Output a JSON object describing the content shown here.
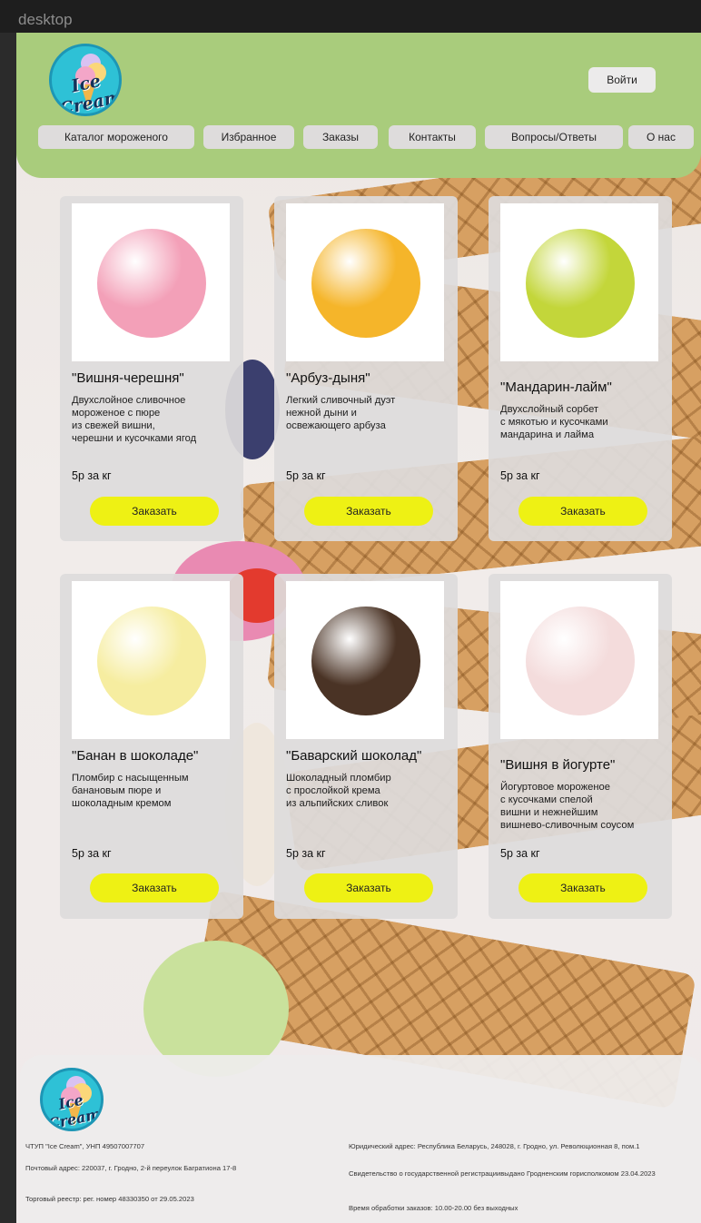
{
  "frame_label": "desktop",
  "header": {
    "logo_text": "Ice Cream",
    "login_label": "Войти",
    "nav": [
      {
        "label": "Каталог мороженого"
      },
      {
        "label": "Избранное"
      },
      {
        "label": "Заказы"
      },
      {
        "label": "Контакты"
      },
      {
        "label": "Вопросы/Ответы"
      },
      {
        "label": "О нас"
      }
    ]
  },
  "products": [
    {
      "title": "\"Вишня-черешня\"",
      "description": "Двухслойное сливочное\nмороженое с пюре\nиз свежей вишни,\nчерешни и кусочками ягод",
      "price": "5р за кг",
      "order_label": "Заказать",
      "color": "#f3a0b8"
    },
    {
      "title": "\"Арбуз-дыня\"",
      "description": "Легкий сливочный дуэт\nнежной дыни и\nосвежающего арбуза",
      "price": "5р за кг",
      "order_label": "Заказать",
      "color": "#f5b52a"
    },
    {
      "title": "\"Мандарин-лайм\"",
      "description": "Двухслойный сорбет\nс мякотью и кусочками\nмандарина и лайма",
      "price": "5р за кг",
      "order_label": "Заказать",
      "color": "#c3d63a"
    },
    {
      "title": "\"Банан в шоколаде\"",
      "description": "Пломбир с насыщенным\nбанановым пюре и\nшоколадным кремом",
      "price": "5р за кг",
      "order_label": "Заказать",
      "color": "#f6eda0"
    },
    {
      "title": "\"Баварский шоколад\"",
      "description": "Шоколадный пломбир\nс прослойкой крема\nиз альпийских сливок",
      "price": "5р за кг",
      "order_label": "Заказать",
      "color": "#4a3325"
    },
    {
      "title": "\"Вишня в йогурте\"",
      "description": "Йогуртовое мороженое\nс кусочками спелой\nвишни и нежнейшим\nвишнево-сливочным соусом",
      "price": "5р за кг",
      "order_label": "Заказать",
      "color": "#f4dcdc"
    }
  ],
  "footer": {
    "logo_text": "Ice Cream",
    "company": "ЧТУП \"Ice Cream\", УНП 49507007707",
    "postal": "Почтовый адрес: 220037, г. Гродно, 2-й переулок Багратиона 17-8",
    "registry": "Торговый реестр: рег. номер 48330350 от 29.05.2023",
    "legal": "Юридический адрес: Республика Беларусь, 248028, г. Гродно, ул. Революционная 8, пом.1",
    "certificate": "Свидетельство о государственной регистрациивыдано Гродненским горисполкомом 23.04.2023",
    "hours": "Время обработки заказов: 10.00-20.00 без выходных"
  },
  "colors": {
    "header_bg": "#a9cc7c",
    "button_yellow": "#eef114",
    "nav_bg": "#dedcdc"
  }
}
